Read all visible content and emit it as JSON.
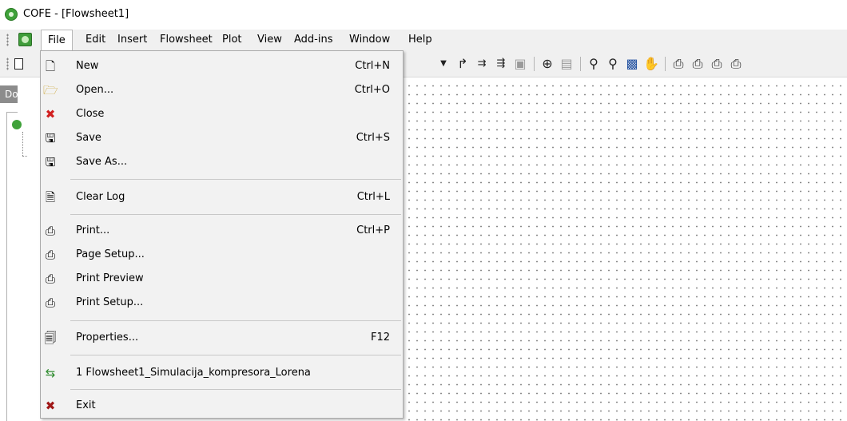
{
  "window": {
    "title": "COFE - [Flowsheet1]"
  },
  "menubar": {
    "items": [
      "File",
      "Edit",
      "Insert",
      "Flowsheet",
      "Plot",
      "View",
      "Add-ins",
      "Window",
      "Help"
    ]
  },
  "document_panel": {
    "header": "Docu"
  },
  "file_menu": {
    "new": {
      "label": "New",
      "shortcut": "Ctrl+N",
      "icon": "new-document-icon"
    },
    "open": {
      "label": "Open...",
      "shortcut": "Ctrl+O",
      "icon": "folder-open-icon"
    },
    "close": {
      "label": "Close",
      "shortcut": "",
      "icon": "close-red-x-icon"
    },
    "save": {
      "label": "Save",
      "shortcut": "Ctrl+S",
      "icon": "floppy-disk-icon"
    },
    "save_as": {
      "label": "Save As...",
      "shortcut": "",
      "icon": "floppy-disk-icon"
    },
    "clear_log": {
      "label": "Clear Log",
      "shortcut": "Ctrl+L",
      "icon": "clear-log-icon"
    },
    "print": {
      "label": "Print...",
      "shortcut": "Ctrl+P",
      "icon": "printer-icon"
    },
    "page_setup": {
      "label": "Page Setup...",
      "shortcut": "",
      "icon": "page-setup-icon"
    },
    "print_preview": {
      "label": "Print Preview",
      "shortcut": "",
      "icon": "print-preview-icon"
    },
    "print_setup": {
      "label": "Print Setup...",
      "shortcut": "",
      "icon": "print-setup-icon"
    },
    "properties": {
      "label": "Properties...",
      "shortcut": "F12",
      "icon": "properties-icon"
    },
    "recent_1": {
      "label": "1 Flowsheet1_Simulacija_kompresora_Lorena",
      "shortcut": "",
      "icon": "recent-file-icon"
    },
    "exit": {
      "label": "Exit",
      "shortcut": "",
      "icon": "exit-x-icon"
    }
  }
}
